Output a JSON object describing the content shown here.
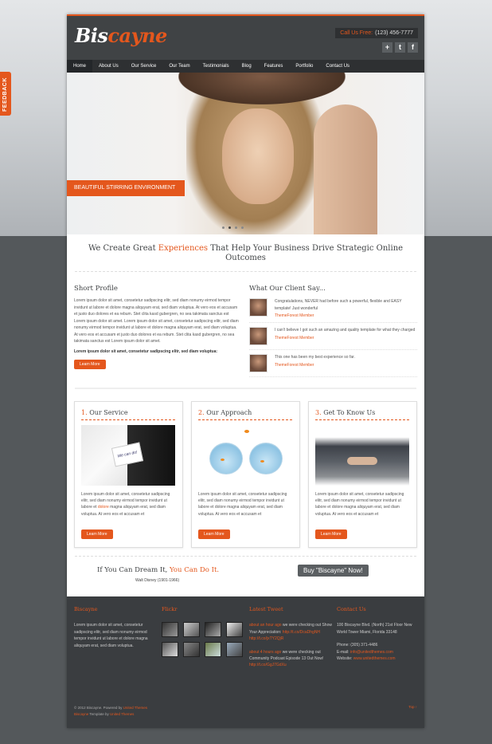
{
  "feedback_tab": "FEEDBACK",
  "logo": {
    "part1": "Bis",
    "part2": "cayne"
  },
  "call": {
    "label": "Call Us Free:",
    "number": "(123) 456-7777"
  },
  "social_icons": [
    "plus-icon",
    "twitter-icon",
    "facebook-icon"
  ],
  "nav": [
    "Home",
    "About Us",
    "Our Service",
    "Our Team",
    "Testimonials",
    "Blog",
    "Features",
    "Portfolio",
    "Contact Us"
  ],
  "slider_caption": "BEAUTIFUL STIRRING ENVIRONMENT",
  "headline": {
    "a": "We Create Great ",
    "b": "Experiences",
    "c": " That Help Your Business Drive Strategic Online Outcomes"
  },
  "profile": {
    "title": "Short Profile",
    "text": "Lorem ipsum dolor sit amet, consetetur sadipscing elitr, sed diam nonumy eirmod tempor invidunt ut labore et dolore magna aliquyam erat, sed diam voluptua. At vero eos et accusam et justo duo dolores et ea rebum. Stet clita kasd gubergren, no sea takimata sanctus est Lorem ipsum dolor sit amet. Lorem ipsum dolor sit amet, consetetur sadipscing elitr, sed diam nonumy eirmod tempor invidunt ut labore et dolore magna aliquyam erat, sed diam voluptua. At vero eos et accusam et justo duo dolores et ea rebum. Stet clita kasd gubergren, no sea takimata sanctus est Lorem ipsum dolor sit amet.",
    "bold": "Lorem ipsum dolor sit amet, consetetur sadipscing elitr, sed diam voluptua:",
    "button": "Learn More"
  },
  "clients": {
    "title": "What Our Client Say...",
    "items": [
      {
        "text": "Congratulations, NEVER had before such a powerful, flexible and EASY template! Just wonderful",
        "name": "ThemeForest Member"
      },
      {
        "text": "I can't believe I got such an amazing and quality template for what they charged",
        "name": "ThemeForest Member"
      },
      {
        "text": "This one has been my best experience so far.",
        "name": "ThemeForest Member"
      }
    ]
  },
  "boxes": [
    {
      "num": "1.",
      "title": "Our Service",
      "text_a": "Lorem ipsum dolor sit amet, consetetur sadipscing elitr, sed diam nonumy eirmod tempor invidunt ut labore et ",
      "highlight": "dolore",
      "text_b": " magna aliquyam erat, sed diam voluptua. At vero eos et accusam et",
      "button": "Learn More",
      "img_text": "We can do!"
    },
    {
      "num": "2.",
      "title": "Our Approach",
      "text": "Lorem ipsum dolor sit amet, consetetur sadipscing elitr, sed diam nonumy eirmod tempor invidunt ut labore et dolore magna aliquyam erat, sed diam voluptua. At vero eos et accusam et",
      "button": "Learn More"
    },
    {
      "num": "3.",
      "title": "Get To Know Us",
      "text": "Lorem ipsum dolor sit amet, consetetur sadipscing elitr, sed diam nonumy eirmod tempor invidunt ut labore et dolore magna aliquyam erat, sed diam voluptua. At vero eos et accusam et",
      "button": "Learn More"
    }
  ],
  "quote": {
    "a": "If You Can Dream It, ",
    "b": "You Can Do It.",
    "author": "Walt Disney (1901-1966)",
    "buy": "Buy \"Biscayne\" Now!"
  },
  "footer": {
    "about": {
      "title": "Biscayne",
      "text": "Lorem ipsum dolor sit amet, consetetur sadipscing elitr, sed diam nonumy eirmod tempor invidunt ut labore et dolore magna aliquyam erat, sed diam voluptua."
    },
    "flickr": {
      "title": "Flickr"
    },
    "tweet": {
      "title": "Latest Tweet",
      "t1_time": "about an hour ago",
      "t1_text": " we were checking out Show Your Appreciation: ",
      "t1_link1": "http://t.co/DcaDhgNH",
      "t1_link2": "http://t.co/jxTY2QjR",
      "t2_time": "about 4 hours ago",
      "t2_text": " we were checking out Community Podcast Episode 13 Out Now! ",
      "t2_link": "http://t.co/GgJ7GdXu"
    },
    "contact": {
      "title": "Contact Us",
      "address": "100 Biscayne Blvd. (North) 21st Floor New World Tower Miami, Florida 33148",
      "phone": "Phone: (305) 371-4486",
      "email_label": "E-mail: ",
      "email": "info@unitedthemes.com",
      "web_label": "Website: ",
      "web": "www.unitedthemes.com"
    },
    "copy1": "© 2012 Biscayne. Powered by ",
    "copy1_link": "United Themes",
    "copy2_a": "Biscayne",
    "copy2_b": " Template by ",
    "copy2_link": "United Themes",
    "top": "Top ↑"
  }
}
